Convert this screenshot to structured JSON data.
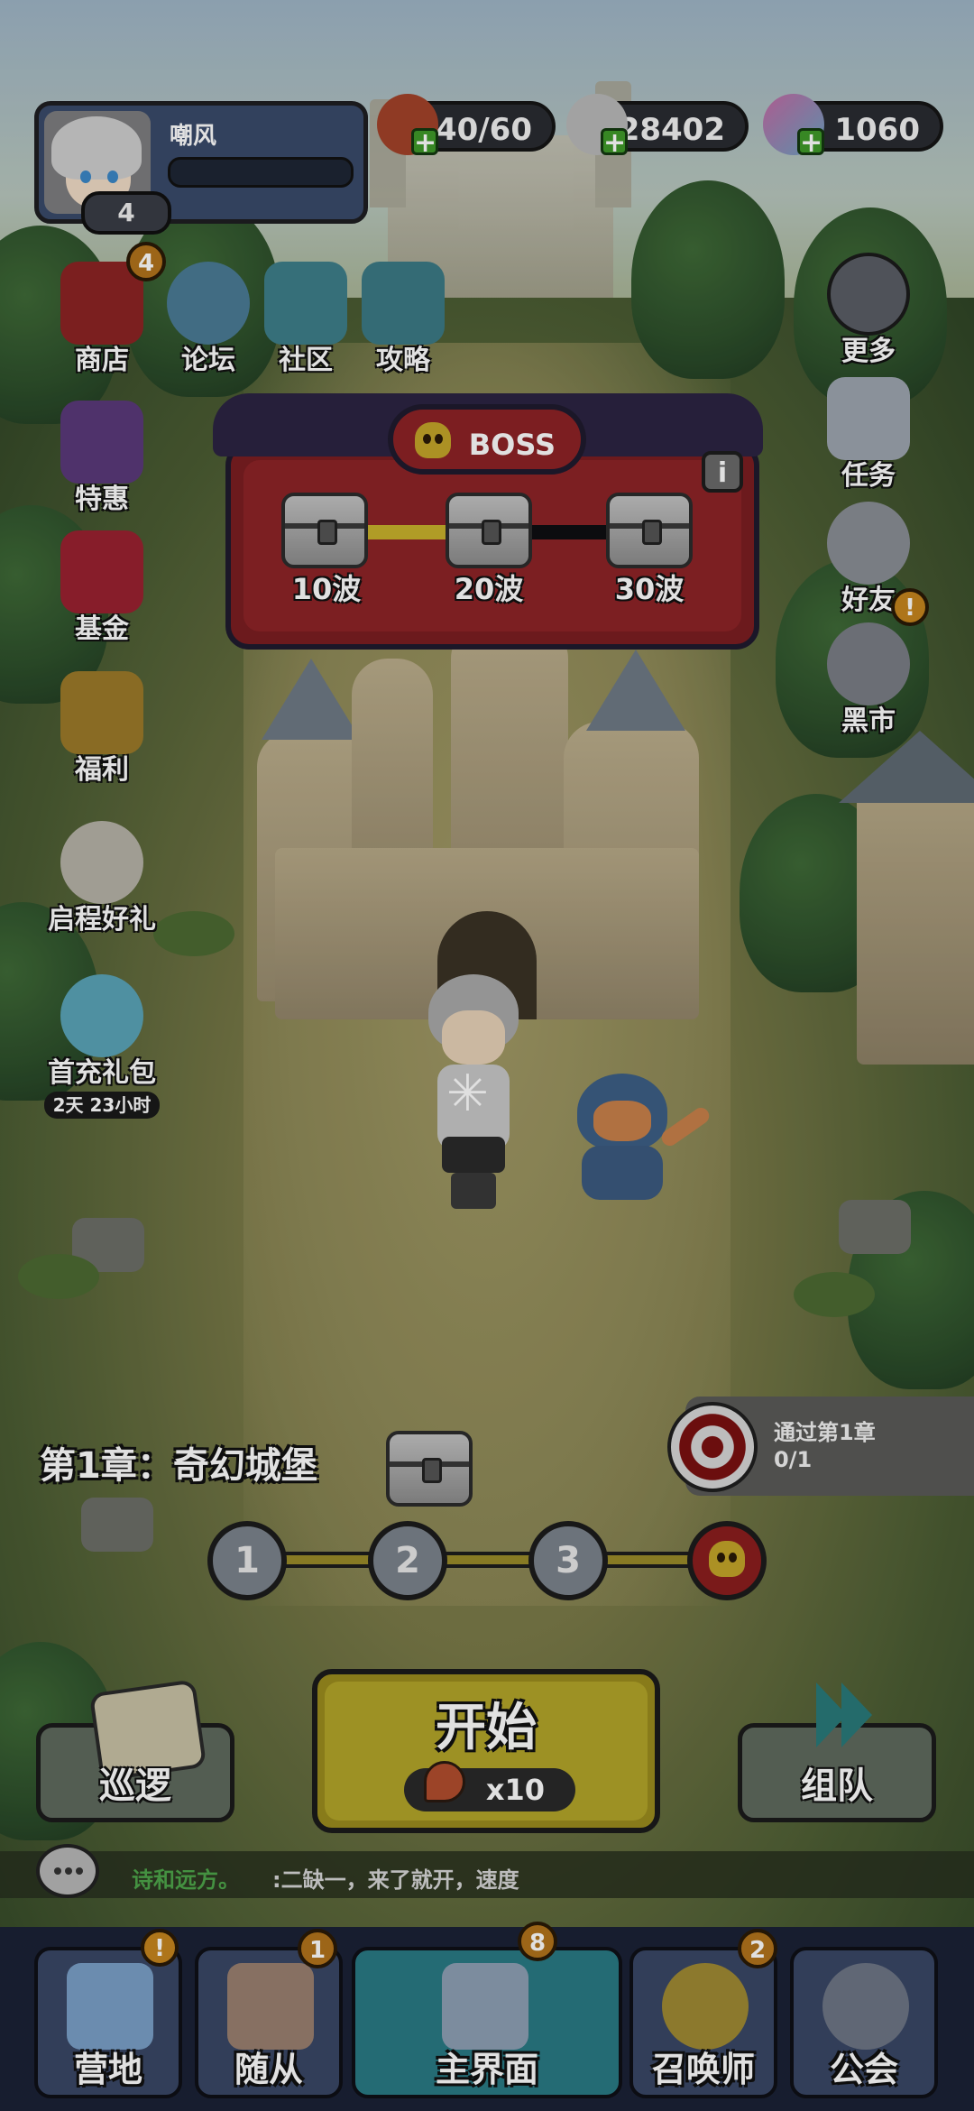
{
  "player": {
    "name": "嘲风",
    "level": "4"
  },
  "resources": [
    {
      "name": "stamina",
      "icon": "meat-icon",
      "value": "140/60"
    },
    {
      "name": "gold",
      "icon": "silver-coins-icon",
      "value": "28402"
    },
    {
      "name": "gems",
      "icon": "gem-icon",
      "value": "1060"
    }
  ],
  "left_menu": [
    {
      "label": "商店",
      "icon": "shop-icon",
      "badge": "4"
    },
    {
      "label": "论坛",
      "icon": "forum-icon"
    },
    {
      "label": "社区",
      "icon": "community-icon"
    },
    {
      "label": "攻略",
      "icon": "guide-icon"
    },
    {
      "label": "特惠",
      "icon": "deal-icon"
    },
    {
      "label": "基金",
      "icon": "fund-icon"
    },
    {
      "label": "福利",
      "icon": "welfare-icon"
    },
    {
      "label": "启程好礼",
      "icon": "journey-gift-icon"
    },
    {
      "label": "首充礼包",
      "icon": "first-recharge-icon",
      "timer": "2天 23小时"
    }
  ],
  "right_menu": [
    {
      "label": "更多",
      "icon": "more-icon"
    },
    {
      "label": "任务",
      "icon": "task-icon"
    },
    {
      "label": "好友",
      "icon": "friends-icon"
    },
    {
      "label": "黑市",
      "icon": "black-market-icon",
      "alert": "!"
    }
  ],
  "boss_panel": {
    "title": "BOSS",
    "waves": [
      "10波",
      "20波",
      "30波"
    ],
    "info": "i"
  },
  "chapter": {
    "title": "第1章：奇幻城堡"
  },
  "stages": [
    "1",
    "2",
    "3"
  ],
  "quest": {
    "title": "通过第1章",
    "progress": "0/1"
  },
  "actions": {
    "patrol": "巡逻",
    "start": "开始",
    "start_cost": "x10",
    "team": "组队"
  },
  "chat": {
    "sender": "诗和远方。",
    "message": ":二缺一，来了就开，速度"
  },
  "bottom_nav": [
    {
      "label": "营地",
      "icon": "camp-icon",
      "badge": "!"
    },
    {
      "label": "随从",
      "icon": "follower-icon",
      "badge": "1"
    },
    {
      "label": "主界面",
      "icon": "main-castle-icon",
      "badge": "8",
      "active": true
    },
    {
      "label": "召唤师",
      "icon": "summoner-icon",
      "badge": "2"
    },
    {
      "label": "公会",
      "icon": "guild-lock-icon"
    }
  ],
  "colors": {
    "accent_yellow": "#b3a62a",
    "boss_red": "#8e2427",
    "nav_active": "#2a7a85",
    "badge": "#b2741c"
  }
}
